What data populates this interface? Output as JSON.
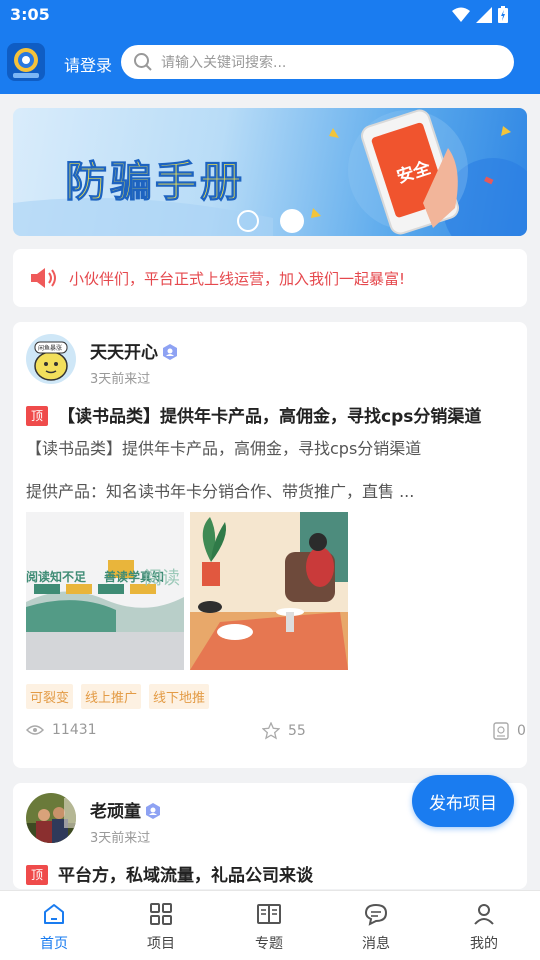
{
  "status_bar": {
    "time": "3:05"
  },
  "header": {
    "login_label": "请登录",
    "search_placeholder": "请输入关键词搜索..."
  },
  "banner": {
    "title": "防骗手册",
    "phone_text": "安全",
    "active_slide": 2,
    "slide_count": 2
  },
  "notice": {
    "text": "小伙伴们，平台正式上线运营，加入我们一起暴富!"
  },
  "posts": [
    {
      "user_name": "天天开心",
      "last_seen": "3天前来过",
      "pinned_label": "顶",
      "title": "【读书品类】提供年卡产品，高佣金，寻找cps分销渠道",
      "desc_1": "【读书品类】提供年卡产品，高佣金，寻找cps分销渠道",
      "desc_2": "提供产品：知名读书年卡分销合作、带货推广，直售 ...",
      "image_1_text": {
        "line_1": "阅读知不足",
        "line_2": "善读学真知",
        "side": "阅读"
      },
      "tags": [
        "可裂变",
        "线上推广",
        "线下地推"
      ],
      "views": "11431",
      "stars": "55",
      "comments": "0",
      "avatar_text": "闲鱼暴涨"
    },
    {
      "user_name": "老顽童",
      "last_seen": "3天前来过",
      "pinned_label": "顶",
      "title": "平台方，私域流量，礼品公司来谈"
    }
  ],
  "fab": {
    "label": "发布项目"
  },
  "tabbar": {
    "items": [
      {
        "label": "首页",
        "icon": "home-icon",
        "active": true
      },
      {
        "label": "项目",
        "icon": "grid-icon",
        "active": false
      },
      {
        "label": "专题",
        "icon": "book-icon",
        "active": false
      },
      {
        "label": "消息",
        "icon": "message-icon",
        "active": false
      },
      {
        "label": "我的",
        "icon": "user-icon",
        "active": false
      }
    ]
  },
  "colors": {
    "primary": "#1a7cf0",
    "notice": "#e5484d",
    "tag_bg": "#fdf1e2",
    "tag_text": "#e39b45",
    "pin": "#ef4b4b"
  }
}
